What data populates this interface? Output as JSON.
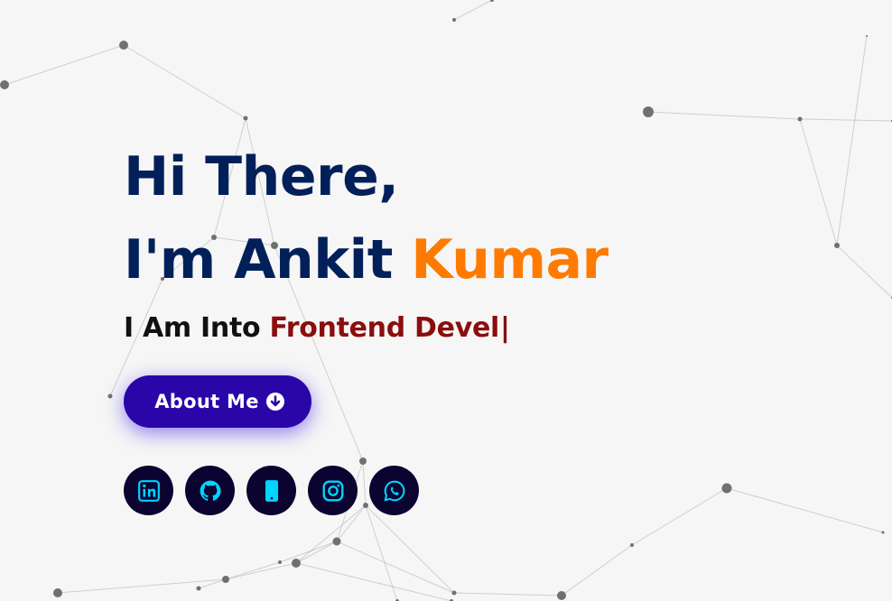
{
  "hero": {
    "greeting_line1": "Hi There,",
    "greeting_line2_prefix": "I'm Ankit ",
    "greeting_line2_highlight": "Kumar",
    "typed_prefix": "I Am Into ",
    "typed_text": "Frontend Devel",
    "typed_cursor": "|"
  },
  "about_button": {
    "label": "About Me",
    "icon": "arrow-circle-down-icon"
  },
  "socials": [
    {
      "name": "linkedin",
      "icon": "linkedin-icon"
    },
    {
      "name": "github",
      "icon": "github-icon"
    },
    {
      "name": "phone",
      "icon": "mobile-phone-icon"
    },
    {
      "name": "instagram",
      "icon": "instagram-icon"
    },
    {
      "name": "whatsapp",
      "icon": "whatsapp-icon"
    }
  ],
  "colors": {
    "background": "#f6f6f6",
    "heading": "#012059",
    "highlight": "#ff7a00",
    "typed": "#8b0d0d",
    "button": "#2a06a8",
    "social_bg": "#0b0330",
    "social_icon": "#00d4ff"
  }
}
